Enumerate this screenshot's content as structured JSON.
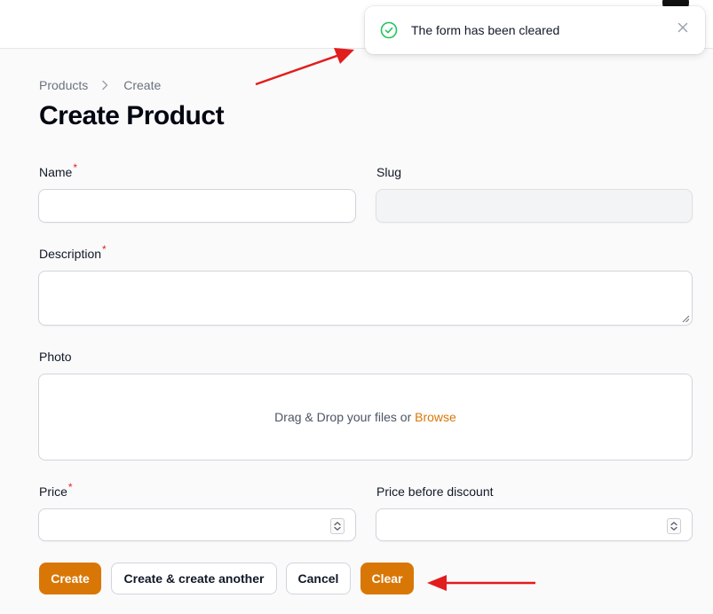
{
  "toast": {
    "message": "The form has been cleared",
    "status_color": "#22c55e"
  },
  "breadcrumb": {
    "items": [
      "Products",
      "Create"
    ]
  },
  "page": {
    "title": "Create Product"
  },
  "form": {
    "name": {
      "label": "Name",
      "required": "*",
      "value": ""
    },
    "slug": {
      "label": "Slug",
      "value": "",
      "disabled": true
    },
    "description": {
      "label": "Description",
      "required": "*",
      "value": ""
    },
    "photo": {
      "label": "Photo",
      "hint": "Drag & Drop your files or ",
      "browse": "Browse"
    },
    "price": {
      "label": "Price",
      "required": "*",
      "value": ""
    },
    "price_before_discount": {
      "label": "Price before discount",
      "value": ""
    }
  },
  "actions": {
    "create": "Create",
    "create_another": "Create & create another",
    "cancel": "Cancel",
    "clear": "Clear"
  },
  "colors": {
    "primary": "#d97706",
    "required": "#dc2626",
    "annotation": "#e11d1d"
  },
  "icons": {
    "toast_status": "check-circle-icon",
    "toast_close": "close-icon",
    "breadcrumb_separator": "chevron-right-icon",
    "number_stepper": "up-down-arrows-icon"
  }
}
